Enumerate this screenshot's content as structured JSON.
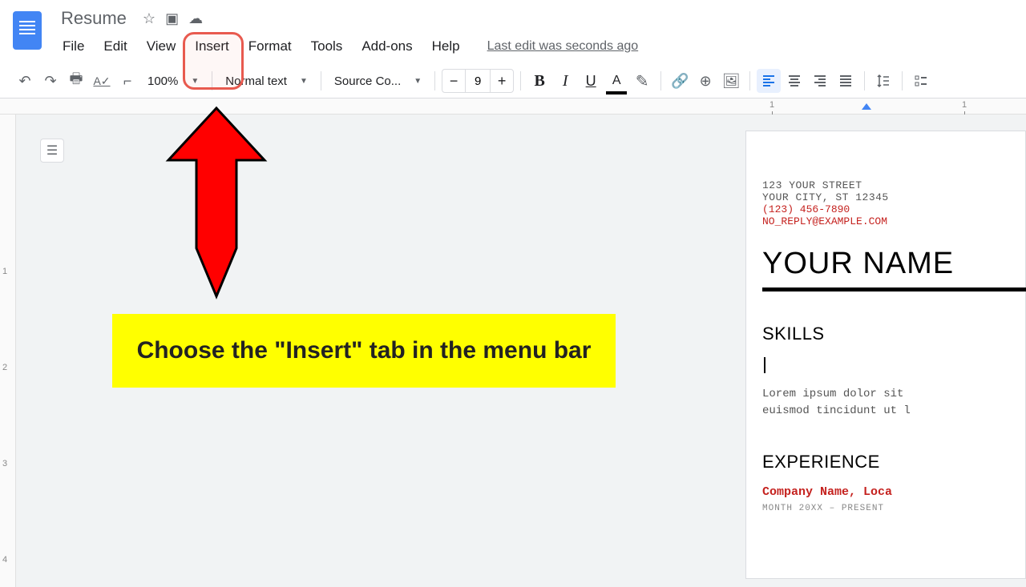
{
  "header": {
    "doc_title": "Resume",
    "last_edit": "Last edit was seconds ago"
  },
  "menu": {
    "file": "File",
    "edit": "Edit",
    "view": "View",
    "insert": "Insert",
    "format": "Format",
    "tools": "Tools",
    "addons": "Add-ons",
    "help": "Help"
  },
  "toolbar": {
    "zoom": "100%",
    "style": "Normal text",
    "font": "Source Co...",
    "font_size": "9"
  },
  "ruler": {
    "mark1": "1",
    "mark2": "1"
  },
  "vruler": {
    "m1": "1",
    "m2": "2",
    "m3": "3",
    "m4": "4"
  },
  "resume": {
    "addr1": "123 YOUR STREET",
    "addr2": "YOUR CITY, ST 12345",
    "phone": "(123) 456-7890",
    "email": "NO_REPLY@EXAMPLE.COM",
    "name": "YOUR NAME",
    "skills": "SKILLS",
    "lorem1": "Lorem ipsum dolor sit",
    "lorem2": "euismod tincidunt ut l",
    "experience": "EXPERIENCE",
    "company": "Company Name, Loca",
    "date": "MONTH 20XX – PRESENT"
  },
  "annotation": {
    "text": "Choose the \"Insert\" tab in the menu bar"
  }
}
